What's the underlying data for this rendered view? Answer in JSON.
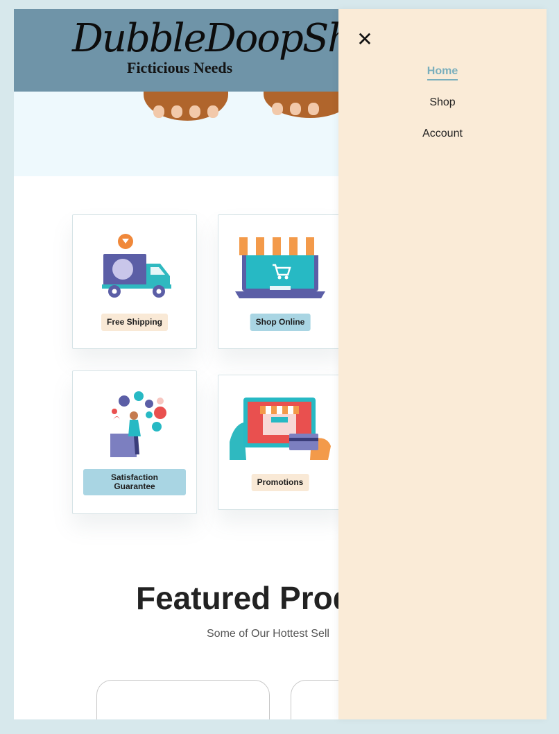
{
  "header": {
    "logo_script": "DubbleDoopShop",
    "logo_subtitle": "Ficticious Needs"
  },
  "features": [
    {
      "label": "Free Shipping",
      "icon": "delivery-truck-icon",
      "label_color": "#f9e9d6"
    },
    {
      "label": "Shop Online",
      "icon": "laptop-store-icon",
      "label_color": "#a9d5e3"
    },
    {
      "label": "Satisfaction\nGuarantee",
      "icon": "happy-customer-icon",
      "label_color": "#a9d5e3"
    },
    {
      "label": "Promotions",
      "icon": "tablet-store-icon",
      "label_color": "#f9e9d6"
    }
  ],
  "featured": {
    "title": "Featured Prod",
    "subtitle": "Some of Our Hottest Sell"
  },
  "drawer": {
    "close_icon": "close-icon",
    "items": [
      {
        "label": "Home",
        "active": true
      },
      {
        "label": "Shop",
        "active": false
      },
      {
        "label": "Account",
        "active": false
      }
    ]
  },
  "colors": {
    "page_bg": "#d7e8ec",
    "header_bg": "#6f94a8",
    "hero_bg": "#eef9fd",
    "drawer_bg": "#faebd7",
    "accent": "#79aebc"
  }
}
